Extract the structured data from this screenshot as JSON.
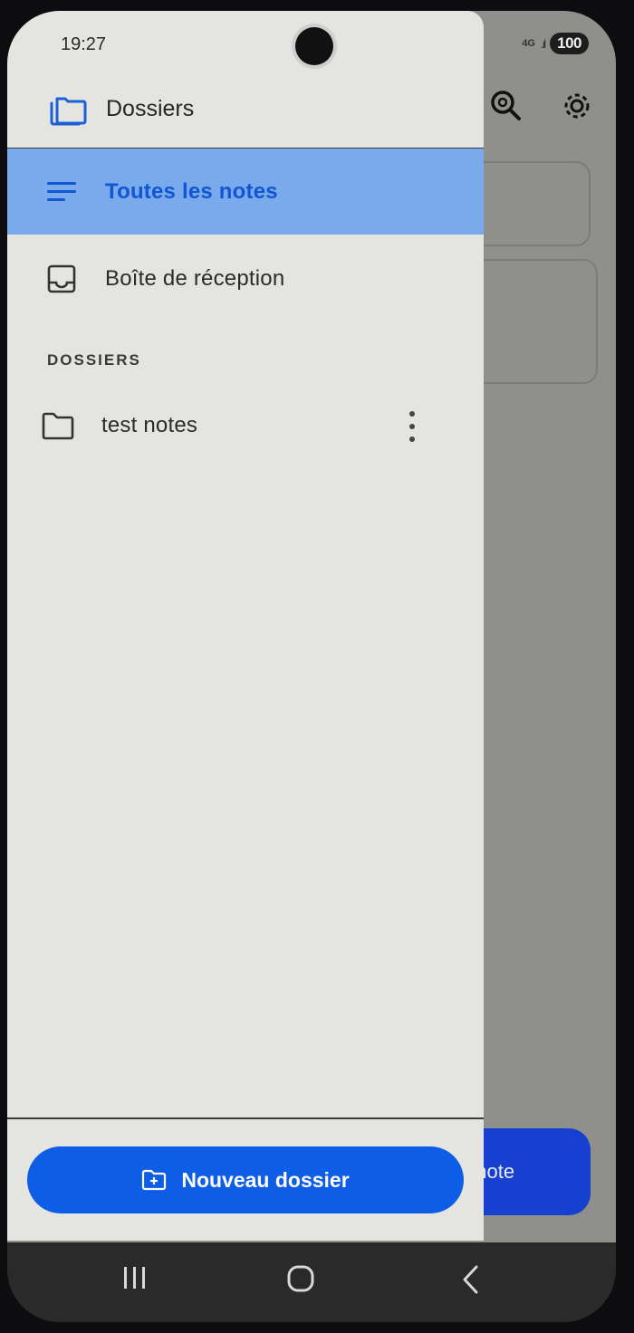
{
  "status_bar": {
    "time": "19:27",
    "network": "4G",
    "battery": "100"
  },
  "background_app": {
    "fab_label": "le note"
  },
  "drawer": {
    "header_title": "Dossiers",
    "nav": [
      {
        "label": "Toutes les notes",
        "icon": "notes-list-icon",
        "active": true
      },
      {
        "label": "Boîte de réception",
        "icon": "inbox-icon",
        "active": false
      }
    ],
    "section_label": "DOSSIERS",
    "folders": [
      {
        "label": "test notes",
        "icon": "folder-icon"
      }
    ],
    "new_folder_button": "Nouveau dossier"
  },
  "colors": {
    "accent": "#0d5de6",
    "active_item_bg": "#79aaeb",
    "active_item_text": "#1256d6"
  }
}
